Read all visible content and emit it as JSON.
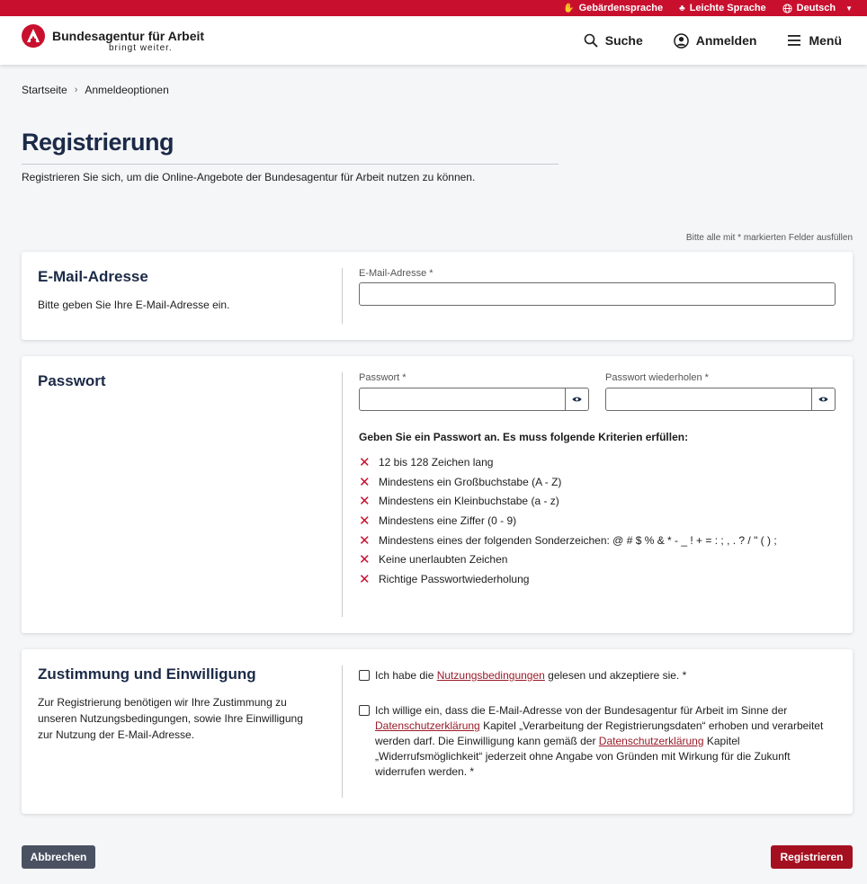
{
  "topbar": {
    "sign_language": "Gebärdensprache",
    "easy_language": "Leichte Sprache",
    "language": "Deutsch"
  },
  "header": {
    "logo_title": "Bundesagentur für Arbeit",
    "logo_sub": "bringt weiter.",
    "search": "Suche",
    "login": "Anmelden",
    "menu": "Menü"
  },
  "breadcrumb": [
    "Startseite",
    "Anmeldeoptionen"
  ],
  "page": {
    "title": "Registrierung",
    "intro": "Registrieren Sie sich, um die Online-Angebote der Bundesagentur für Arbeit nutzen zu können.",
    "required_hint": "Bitte alle mit * markierten Felder ausfüllen"
  },
  "email_section": {
    "title": "E-Mail-Adresse",
    "description": "Bitte geben Sie Ihre E-Mail-Adresse ein.",
    "field_label": "E-Mail-Adresse *",
    "value": ""
  },
  "password_section": {
    "title": "Passwort",
    "password_label": "Passwort *",
    "repeat_label": "Passwort wiederholen *",
    "criteria_heading": "Geben Sie ein Passwort an. Es muss folgende Kriterien erfüllen:",
    "criteria": [
      "12 bis 128 Zeichen lang",
      "Mindestens ein Großbuchstabe (A - Z)",
      "Mindestens ein Kleinbuchstabe (a - z)",
      "Mindestens eine Ziffer (0 - 9)",
      "Mindestens eines der folgenden Sonderzeichen: @ # $ % & * - _ ! + = : ; , . ? / \" ( ) ;",
      "Keine unerlaubten Zeichen",
      "Richtige Passwortwiederholung"
    ]
  },
  "consent_section": {
    "title": "Zustimmung und Einwilligung",
    "description": "Zur Registrierung benötigen wir Ihre Zustimmung zu unseren Nutzungsbedingungen, sowie Ihre Einwilligung zur Nutzung der E-Mail-Adresse.",
    "terms_pre": "Ich habe die ",
    "terms_link": "Nutzungsbedingungen",
    "terms_post": " gelesen und akzeptiere sie. *",
    "privacy_pre": "Ich willige ein, dass die E-Mail-Adresse von der Bundesagentur für Arbeit im Sinne der ",
    "privacy_link1": "Datenschutzerklärung",
    "privacy_mid": " Kapitel „Verarbeitung der Registrierungsdaten“ erhoben und verarbeitet werden darf. Die Einwilligung kann gemäß der ",
    "privacy_link2": "Datenschutzerklärung",
    "privacy_post": " Kapitel „Widerrufsmöglichkeit“ jederzeit ohne Angabe von Gründen mit Wirkung für die Zukunft widerrufen werden. *"
  },
  "actions": {
    "cancel": "Abbrechen",
    "register": "Registrieren"
  },
  "colors": {
    "brand_red": "#c8102e",
    "title_navy": "#1b2a47",
    "register_button": "#a4101f",
    "cancel_button": "#4a5262"
  }
}
